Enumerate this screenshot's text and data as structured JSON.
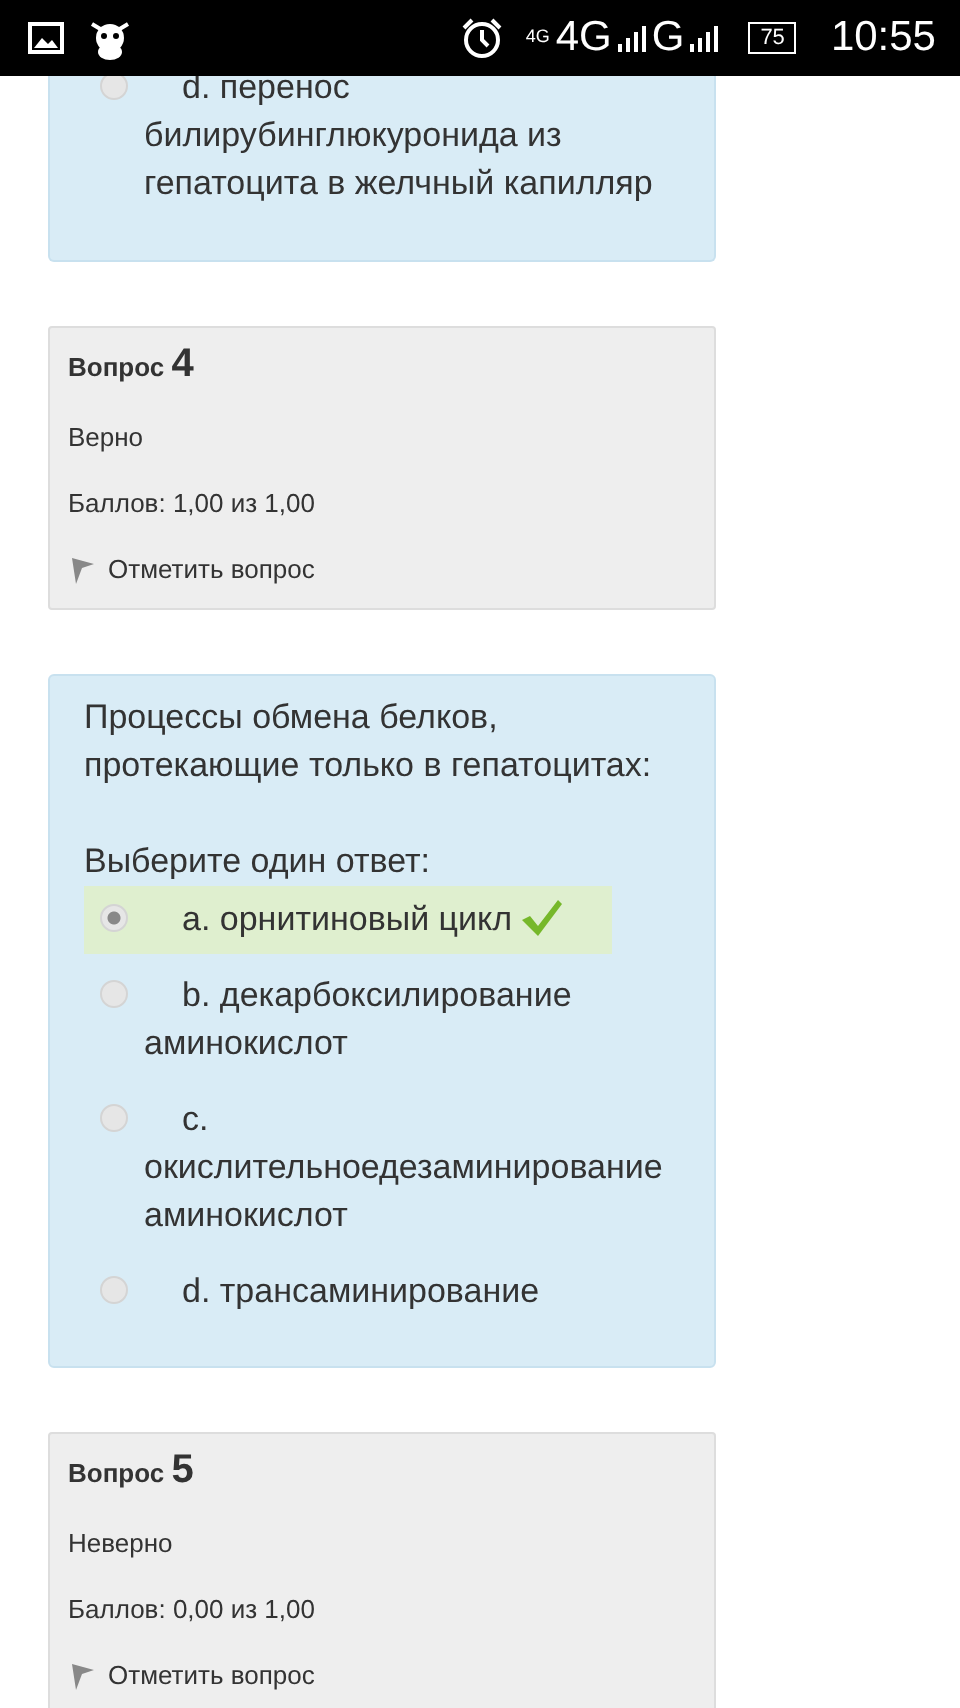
{
  "status_bar": {
    "network_small": "4G",
    "network_1": "4G",
    "network_2": "G",
    "battery": "75",
    "time": "10:55"
  },
  "blocks": [
    {
      "kind": "answers",
      "answers": [
        {
          "label": "d. перенос билирубинглюкуронида из гепатоцита в желчный капилляр",
          "selected": false,
          "correct": false
        }
      ]
    },
    {
      "kind": "info",
      "label": "Вопрос",
      "number": "4",
      "state": "Верно",
      "grade": "Баллов: 1,00 из 1,00",
      "flag": "Отметить вопрос"
    },
    {
      "kind": "question",
      "text": "Процессы обмена белков, протекающие только в гепатоцитах:",
      "prompt": "Выберите один ответ:",
      "answers": [
        {
          "label": "a. орнитиновый цикл",
          "selected": true,
          "correct": true
        },
        {
          "label": "b. декарбоксилирование аминокислот",
          "selected": false,
          "correct": false
        },
        {
          "label": "c. окислительноедезаминирование аминокислот",
          "selected": false,
          "correct": false
        },
        {
          "label": "d. трансаминирование",
          "selected": false,
          "correct": false
        }
      ]
    },
    {
      "kind": "info",
      "label": "Вопрос",
      "number": "5",
      "state": "Неверно",
      "grade": "Баллов: 0,00 из 1,00",
      "flag": "Отметить вопрос"
    }
  ]
}
